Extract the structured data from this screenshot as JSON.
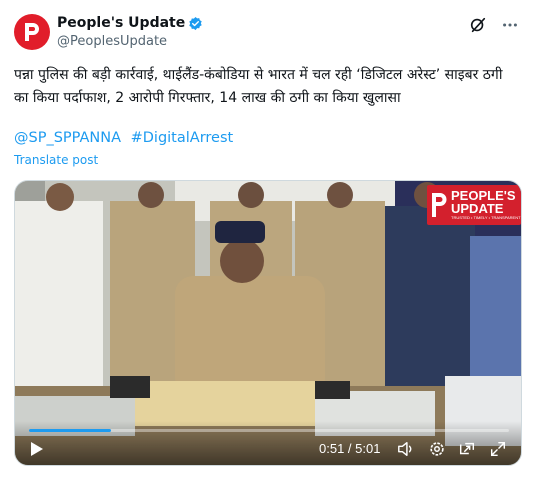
{
  "account": {
    "display_name": "People's Update",
    "handle": "@PeoplesUpdate"
  },
  "icons": {
    "verified": "verified-badge-icon",
    "grok": "grok-icon",
    "more": "more-options-icon",
    "play": "play-icon",
    "volume": "volume-icon",
    "settings": "gear-icon",
    "pip": "picture-in-picture-icon",
    "fullscreen": "fullscreen-icon"
  },
  "post": {
    "text": "पन्ना पुलिस की बड़ी कार्रवाई, थाईलैंड-कंबोडिया से भारत में चल रही ‘डिजिटल अरेस्ट’ साइबर ठगी का किया पर्दाफाश, 2 आरोपी गिरफ्तार, 14 लाख की ठगी का किया खुलासा",
    "hashtags": [
      "@SP_SPPANNA",
      "#DigitalArrest"
    ],
    "translate_label": "Translate post"
  },
  "video": {
    "badge_title": "PEOPLE'S\nUPDATE",
    "badge_sub": "TRUSTED • TIMELY • TRANSPARENT",
    "time_display": "0:51 / 5:01",
    "progress": 0.17
  },
  "colors": {
    "brand_red": "#e11d2a",
    "link_blue": "#1d9bf0",
    "text": "#0f1419",
    "muted": "#536471"
  }
}
